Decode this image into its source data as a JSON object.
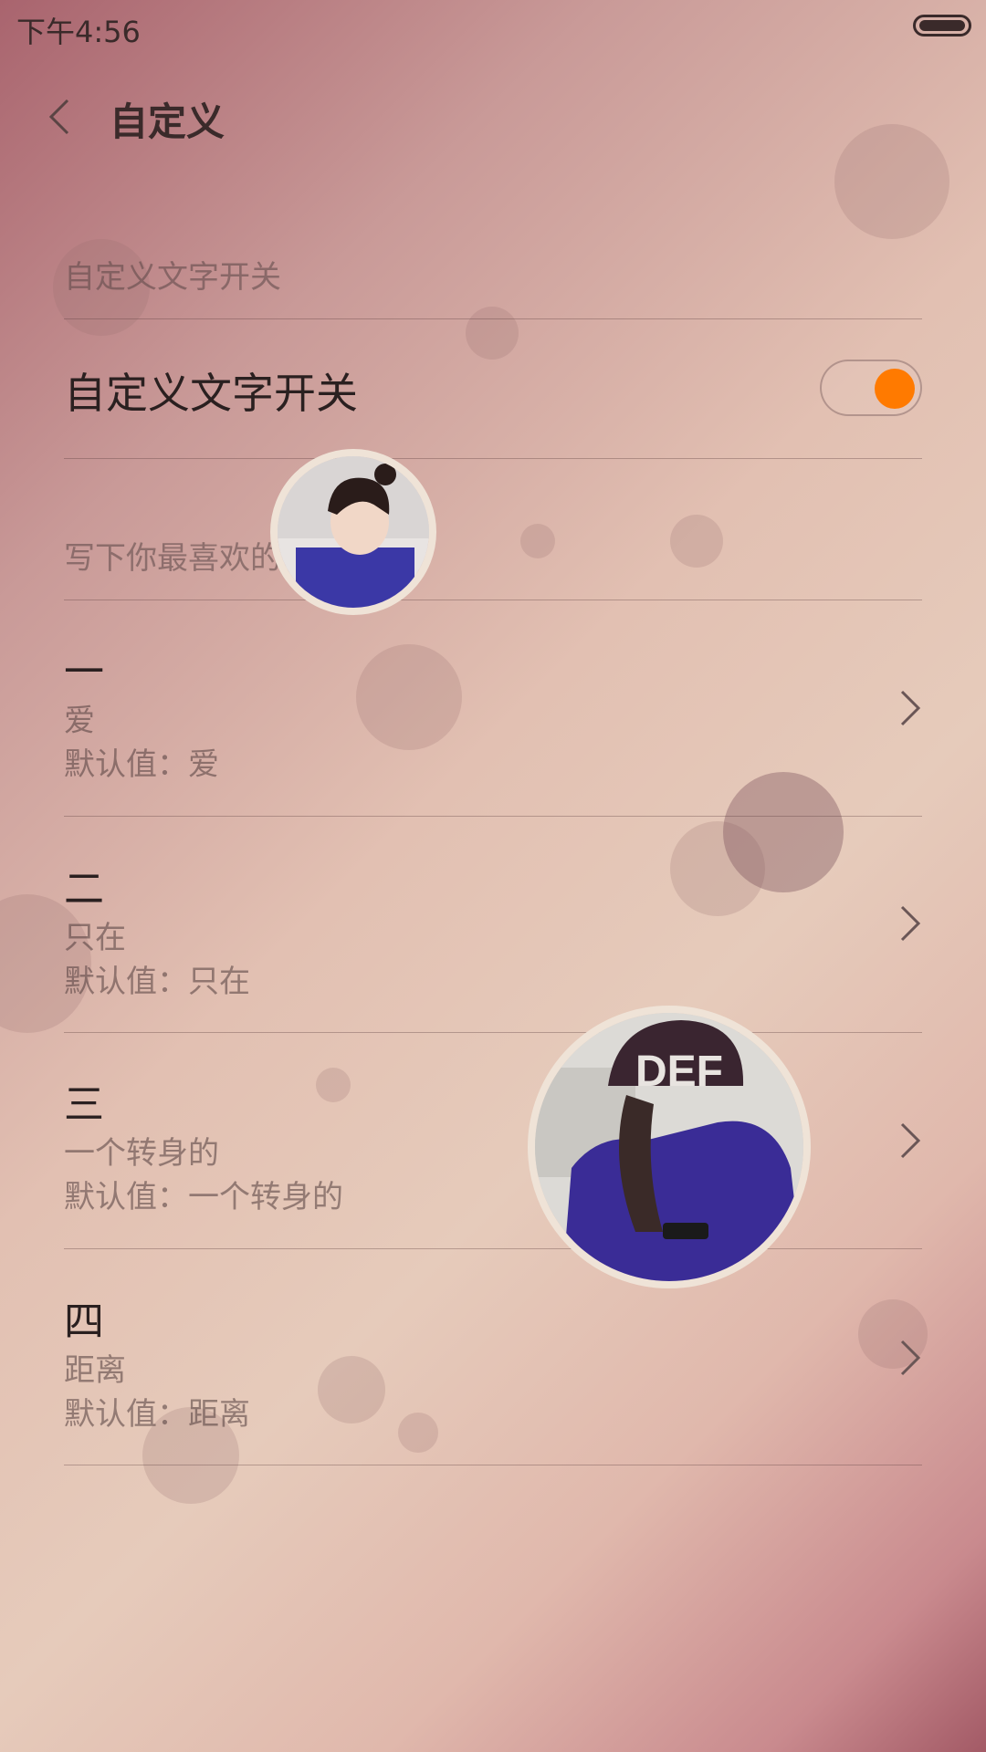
{
  "status_bar": {
    "time": "下午4:56"
  },
  "header": {
    "title": "自定义"
  },
  "section_toggle": {
    "label": "自定义文字开关"
  },
  "toggle_row": {
    "label": "自定义文字开关",
    "enabled": true,
    "accent": "#ff7a00"
  },
  "section_sentence": {
    "label": "写下你最喜欢的句子"
  },
  "items": [
    {
      "title": "一",
      "value": "爱",
      "default": "默认值：爱"
    },
    {
      "title": "二",
      "value": "只在",
      "default": "默认值：只在"
    },
    {
      "title": "三",
      "value": "一个转身的",
      "default": "默认值：一个转身的"
    },
    {
      "title": "四",
      "value": "距离",
      "default": "默认值：距离"
    }
  ],
  "icons": [
    "back-chevron-icon",
    "chevron-right-icon",
    "battery-icon"
  ]
}
